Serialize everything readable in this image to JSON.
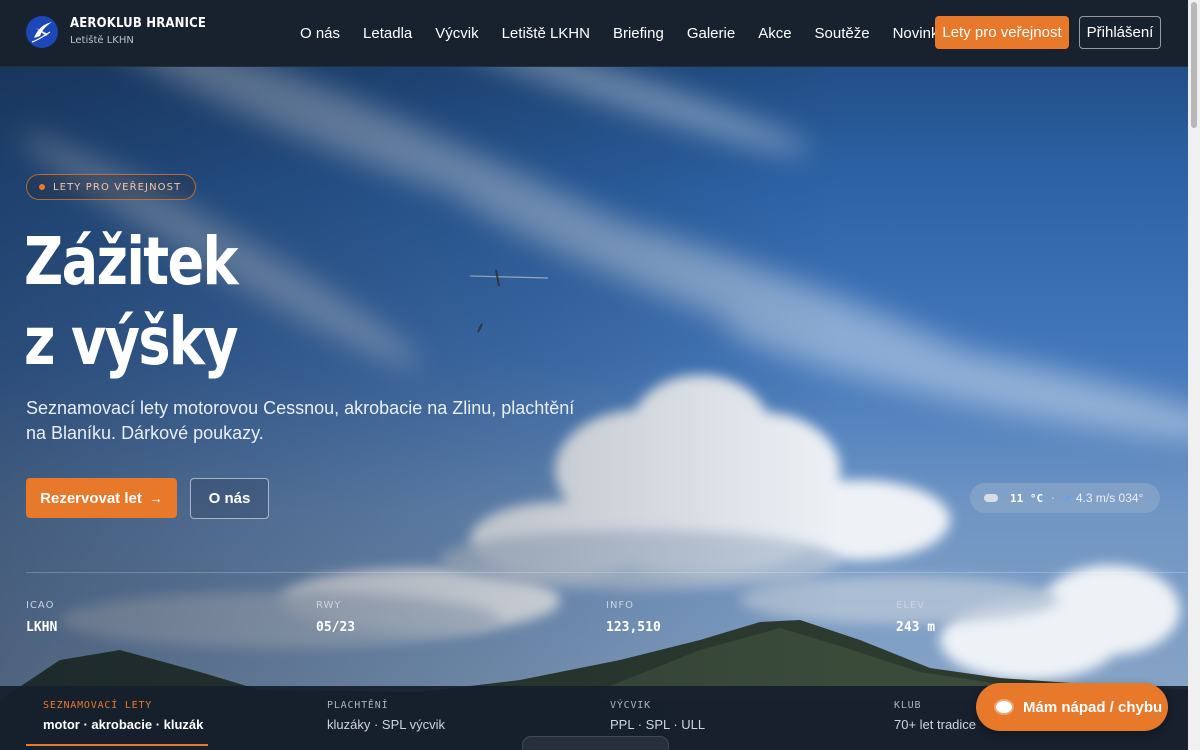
{
  "brand": {
    "name": "AEROKLUB HRANICE",
    "subtitle": "Letiště LKHN"
  },
  "nav": {
    "items": [
      "O nás",
      "Letadla",
      "Výcvik",
      "Letiště LKHN",
      "Briefing",
      "Galerie",
      "Akce",
      "Soutěže",
      "Novinky"
    ]
  },
  "header_buttons": {
    "public_flights": "Lety pro veřejnost",
    "login": "Přihlášení"
  },
  "hero": {
    "badge": "LETY PRO VEŘEJNOST",
    "title_line1": "Zážitek",
    "title_line2": "z výšky",
    "subtitle": "Seznamovací lety motorovou Cessnou, akrobacie na Zlinu, plachtění na Blaníku. Dárkové poukazy.",
    "primary_button": "Rezervovat let",
    "primary_arrow": "→",
    "secondary_button": "O nás"
  },
  "weather": {
    "temperature": "11 °C",
    "separator": "·",
    "wind": "4.3 m/s 034°",
    "icon": "cloud-icon",
    "wind_icon": "wind-arrow-icon"
  },
  "stats": [
    {
      "label": "ICAO",
      "value": "LKHN"
    },
    {
      "label": "RWY",
      "value": "05/23"
    },
    {
      "label": "INFO",
      "value": "123,510"
    },
    {
      "label": "ELEV",
      "value": "243 m"
    }
  ],
  "categories": [
    {
      "label": "SEZNAMOVACÍ LETY",
      "desc": "motor · akrobacie · kluzák",
      "active": true
    },
    {
      "label": "PLACHTĚNÍ",
      "desc": "kluzáky · SPL výcvik",
      "active": false
    },
    {
      "label": "VÝCVIK",
      "desc": "PPL · SPL · ULL",
      "active": false
    },
    {
      "label": "KLUB",
      "desc": "70+ let tradice",
      "active": false
    }
  ],
  "feedback": {
    "label": "Mám nápad / chybu",
    "icon": "chat-bubble-icon"
  },
  "colors": {
    "accent": "#e8782a",
    "header_bg": "#18212e",
    "logo_blue": "#1d46b8"
  }
}
